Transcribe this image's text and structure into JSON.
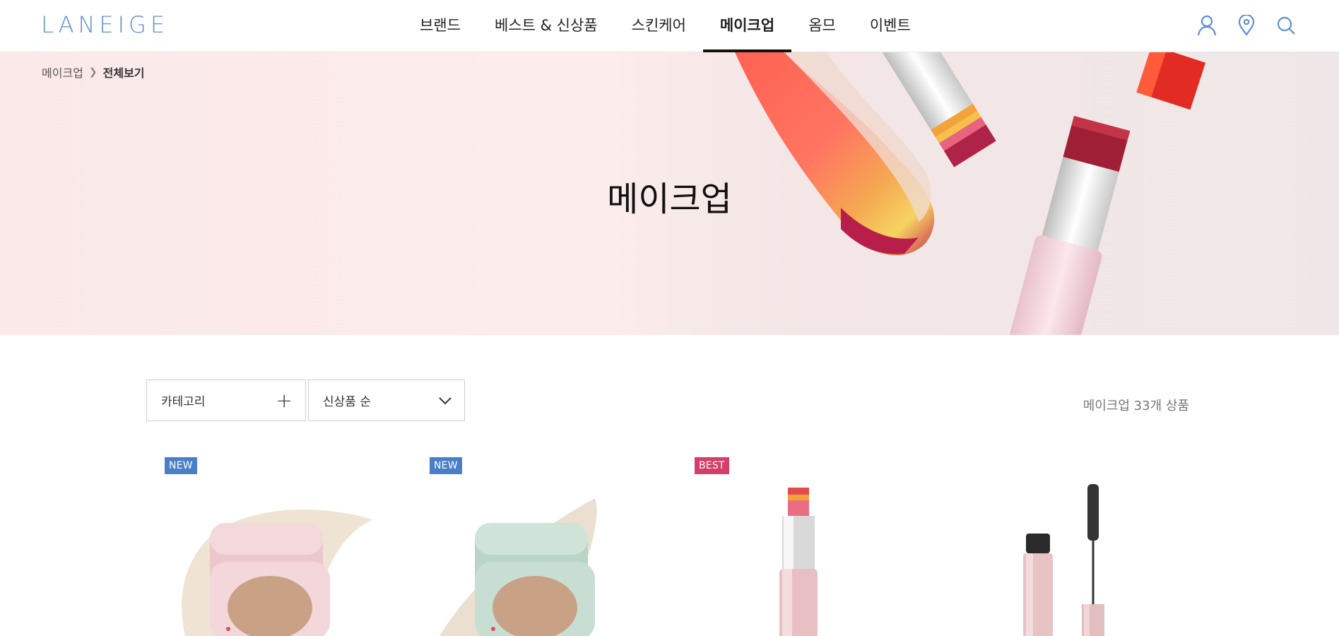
{
  "header": {
    "logo": "LANEIGE",
    "nav": [
      {
        "label": "브랜드"
      },
      {
        "label": "베스트 & 신상품"
      },
      {
        "label": "스킨케어"
      },
      {
        "label": "메이크업",
        "active": true
      },
      {
        "label": "옴므"
      },
      {
        "label": "이벤트"
      }
    ],
    "icons": [
      "user-icon",
      "location-icon",
      "search-icon"
    ],
    "accent_color": "#5f8fd0"
  },
  "breadcrumb": {
    "root": "메이크업",
    "current": "전체보기"
  },
  "hero": {
    "title": "메이크업"
  },
  "filters": {
    "category_label": "카테고리",
    "sort_label": "신상품 순"
  },
  "product_count": "메이크업 33개 상품",
  "products": [
    {
      "badge": "NEW",
      "badge_color": "#4a7fc8",
      "image": "pink-cushion-compact"
    },
    {
      "badge": "NEW",
      "badge_color": "#4a7fc8",
      "image": "mint-cushion-compact"
    },
    {
      "badge": "BEST",
      "badge_color": "#d43e68",
      "image": "two-tone-lip-bar"
    },
    {
      "badge": "",
      "badge_color": "",
      "image": "mascara"
    }
  ]
}
